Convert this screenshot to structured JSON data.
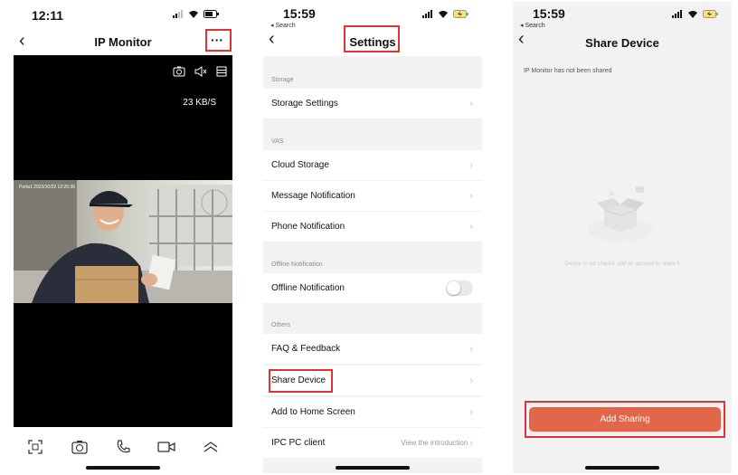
{
  "phone1": {
    "time": "12:11",
    "title": "IP Monitor",
    "more_label": "···",
    "speed": "23 KB/S",
    "timestamp": "Porta1 2022/10/22 12:25:36",
    "bottom_icons": [
      "fullscreen-icon",
      "camera-icon",
      "call-icon",
      "record-icon",
      "chevron-up-icon"
    ]
  },
  "phone2": {
    "time": "15:59",
    "back_app": "◂ Search",
    "title": "Settings",
    "sections": [
      {
        "header": "Storage",
        "rows": [
          {
            "label": "Storage Settings"
          }
        ]
      },
      {
        "header": "VAS",
        "rows": [
          {
            "label": "Cloud Storage"
          },
          {
            "label": "Message Notification"
          },
          {
            "label": "Phone Notification"
          }
        ]
      },
      {
        "header": "Offline Notification",
        "rows": [
          {
            "label": "Offline Notification",
            "toggle": false
          }
        ]
      },
      {
        "header": "Others",
        "rows": [
          {
            "label": "FAQ & Feedback"
          },
          {
            "label": "Share Device"
          },
          {
            "label": "Add to Home Screen"
          },
          {
            "label": "IPC PC client",
            "value": "View the introduction"
          }
        ]
      }
    ]
  },
  "phone3": {
    "time": "15:59",
    "back_app": "◂ Search",
    "title": "Share Device",
    "status_text": "IP Monitor  has not been shared",
    "empty_text": "Device is not shared, add an account to share it",
    "button_label": "Add Sharing"
  },
  "colors": {
    "highlight": "#e03434",
    "button": "#e2674a",
    "background": "#f2f2f3"
  }
}
